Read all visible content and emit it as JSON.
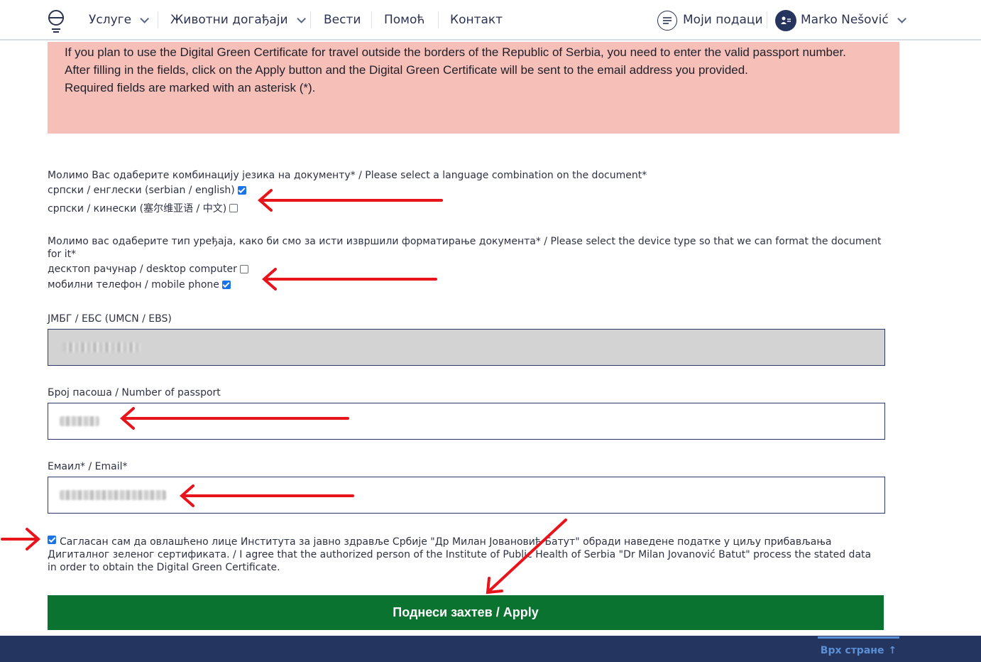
{
  "nav": {
    "items": [
      {
        "label": "Услуге"
      },
      {
        "label": "Животни догађаји"
      },
      {
        "label": "Вести"
      },
      {
        "label": "Помоћ"
      },
      {
        "label": "Контакт"
      }
    ],
    "my_data": "Моји подаци",
    "user_name": "Marko Nešović"
  },
  "info": {
    "lines": [
      "If you plan to use the Digital Green Certificate for travel outside the borders of the Republic of Serbia, you need to enter the valid passport number.",
      "After filling in the fields, click on the Apply button and the Digital Green Certificate will be sent to the email address you provided.",
      "Required fields are marked with an asterisk (*)."
    ]
  },
  "language": {
    "question": "Молимо Вас одаберите комбинацију језика на документу* / Please select a language combination on the document*",
    "options": [
      {
        "label": "српски / енглески (serbian / english)",
        "checked": true
      },
      {
        "label": "српски / кинески (塞尔维亚语 / 中文)",
        "checked": false
      }
    ]
  },
  "device": {
    "question": "Молимо вас одаберите тип уређаја, како би смо за исти извршили форматирање документа* / Please select the device type so that we can format the document for it*",
    "options": [
      {
        "label": "десктоп рачунар / desktop computer",
        "checked": false
      },
      {
        "label": "мобилни телефон / mobile phone",
        "checked": true
      }
    ]
  },
  "fields": {
    "umcn_label": "ЈМБГ / ЕБС (UMCN / EBS)",
    "passport_label": "Број пасоша / Number of passport",
    "email_label": "Емаил* / Email*"
  },
  "consent": {
    "checked": true,
    "text": "Сагласан сам да овлашћено лице Института за јавно здравље Србије \"Др Милан Јовановић Батут\" обради наведене податке у циљу прибављања Дигиталног зеленог сертификата. / I agree that the authorized person of the Institute of Public Health of Serbia \"Dr Milan Jovanović Batut\" process the stated data in order to obtain the Digital Green Certificate."
  },
  "apply_label": "Поднеси захтев / Apply",
  "back_to_top": "Врх стране",
  "colors": {
    "info_bg": "#f6c0b8",
    "apply_green": "#0a7330",
    "footer_navy": "#24355f",
    "annotation_red": "#e8141c"
  }
}
